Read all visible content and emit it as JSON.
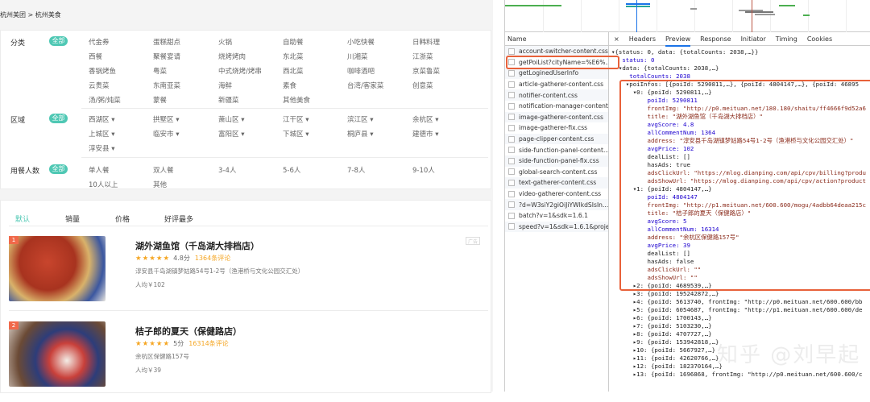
{
  "breadcrumb": "杭州美团 > 杭州美食",
  "filters": [
    {
      "label": "分类",
      "all": "全部",
      "items": [
        "代金券",
        "蛋糕甜点",
        "火锅",
        "自助餐",
        "小吃快餐",
        "日韩料理",
        "西餐",
        "聚餐宴请",
        "烧烤烤肉",
        "东北菜",
        "川湘菜",
        "江浙菜",
        "香锅烤鱼",
        "粤菜",
        "中式烧烤/烤串",
        "西北菜",
        "咖啡酒吧",
        "京菜鲁菜",
        "云贵菜",
        "东南亚菜",
        "海鲜",
        "素食",
        "台湾/客家菜",
        "创意菜",
        "汤/粥/炖菜",
        "蒙餐",
        "新疆菜",
        "其他美食"
      ]
    },
    {
      "label": "区域",
      "all": "全部",
      "items": [
        "西湖区 ▾",
        "拱墅区 ▾",
        "萧山区 ▾",
        "江干区 ▾",
        "滨江区 ▾",
        "余杭区 ▾",
        "上城区 ▾",
        "临安市 ▾",
        "富阳区 ▾",
        "下城区 ▾",
        "桐庐县 ▾",
        "建德市 ▾",
        "淳安县 ▾"
      ]
    },
    {
      "label": "用餐人数",
      "all": "全部",
      "items": [
        "单人餐",
        "双人餐",
        "3-4人",
        "5-6人",
        "7-8人",
        "9-10人",
        "10人以上",
        "其他"
      ]
    }
  ],
  "sort_tabs": [
    "默认",
    "销量",
    "价格",
    "好评最多"
  ],
  "ad_tag": "广告",
  "pois": [
    {
      "rank": "1",
      "title": "湖外湖鱼馆（千岛湖大排档店）",
      "stars": "★★★★★",
      "score": "4.8分",
      "comments": "1364条评论",
      "address": "淳安县千岛湖镇梦姑路54号1-2号（渔港桥与文化公园交汇处）",
      "price": "人均￥102"
    },
    {
      "rank": "2",
      "title": "桔子郎的夏天（保健路店）",
      "stars": "★★★★★",
      "score": "5分",
      "comments": "16314条评论",
      "address": "余杭区保健路157号",
      "price": "人均￥39"
    }
  ],
  "devtools": {
    "name_header": "Name",
    "requests": [
      "account-switcher-content.css",
      "getPoiList?cityName=%E6%...",
      "getLoginedUserInfo",
      "article-gatherer-content.css",
      "notifier-content.css",
      "notification-manager-content...",
      "image-gatherer-content.css",
      "image-gatherer-fix.css",
      "page-clipper-content.css",
      "side-function-panel-content....",
      "side-function-panel-fix.css",
      "global-search-content.css",
      "text-gatherer-content.css",
      "video-gatherer-content.css",
      "?d=W3siY2giOiJiYWlkdSIsIn...",
      "batch?v=1&sdk=1.6.1",
      "speed?v=1&sdk=1.6.1&proje..."
    ],
    "close": "×",
    "tabs": [
      "Headers",
      "Preview",
      "Response",
      "Initiator",
      "Timing",
      "Cookies"
    ],
    "active_tab": "Preview",
    "code_lines": [
      "▾{status: 0, data: {totalCounts: 2038,…}}",
      "   status: 0",
      "  ▾data: {totalCounts: 2038,…}",
      "     totalCounts: 2038",
      "    ▾poiInfos: [{poiId: 5290811,…}, {poiId: 4804147,…}, {poiId: 46895",
      "      ▾0: {poiId: 5290811,…}",
      "          poiId: 5290811",
      "          frontImg: \"http://p0.meituan.net/180.180/shaitu/ff4666f9d52a6",
      "          title: \"湖外湖鱼馆（千岛湖大排档店）\"",
      "          avgScore: 4.8",
      "          allCommentNum: 1364",
      "          address: \"淳安县千岛湖镇梦姑路54号1-2号（渔港桥与文化公园交汇处）\"",
      "          avgPrice: 102",
      "          dealList: []",
      "          hasAds: true",
      "          adsClickUrl: \"https://mlog.dianping.com/api/cpv/billing?produ",
      "          adsShowUrl: \"https://mlog.dianping.com/api/cpv/action?product",
      "      ▾1: {poiId: 4804147,…}",
      "          poiId: 4804147",
      "          frontImg: \"http://p1.meituan.net/600.600/mogu/4adbb64deaa215c",
      "          title: \"桔子郎的夏天（保健路店）\"",
      "          avgScore: 5",
      "          allCommentNum: 16314",
      "          address: \"余杭区保健路157号\"",
      "          avgPrice: 39",
      "          dealList: []",
      "          hasAds: false",
      "          adsClickUrl: \"\"",
      "          adsShowUrl: \"\"",
      "      ▸2: {poiId: 4689539,…}",
      "      ▸3: {poiId: 195242872,…}",
      "      ▸4: {poiId: 5613740, frontImg: \"http://p0.meituan.net/600.600/bb",
      "      ▸5: {poiId: 6054687, frontImg: \"http://p1.meituan.net/600.600/de",
      "      ▸6: {poiId: 1700143,…}",
      "      ▸7: {poiId: 5103230,…}",
      "      ▸8: {poiId: 4707727,…}",
      "      ▸9: {poiId: 153942818,…}",
      "      ▸10: {poiId: 5667927,…}",
      "      ▸11: {poiId: 42620766,…}",
      "      ▸12: {poiId: 182370164,…}",
      "      ▸13: {poiId: 1696868, frontImg: \"http://p0.meituan.net/600.600/c"
    ]
  },
  "watermark": "知乎 @刘早起",
  "colors": {
    "accent": "#4fc8b4",
    "highlight": "#e8613a",
    "star": "#f5a623"
  }
}
